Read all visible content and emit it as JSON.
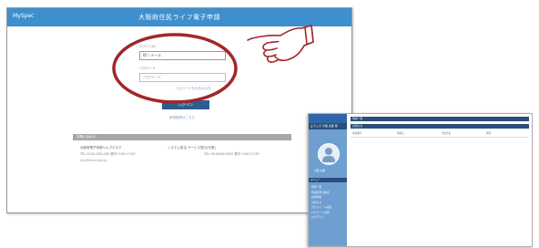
{
  "login_screen": {
    "header": {
      "brand": "MySpec",
      "title": "大阪府住民ライフ電子申請"
    },
    "form": {
      "login_id_label": "ログインID",
      "login_id_value": "ID / メール",
      "password_label": "パスワード",
      "password_placeholder": "パスワード",
      "forgot_link": "パスワードをお忘れの方",
      "login_button": "ログイン",
      "signup_link": "新規登録はこちら"
    },
    "notice": {
      "heading": "お問い合わせ",
      "contacts": [
        {
          "name": "大阪府電子申請ヘルプデスク",
          "tel": "TEL 0120-000-000  受付 9:00-17:00",
          "mail": "info@example.jp"
        },
        {
          "name": "システム担当  サービス窓口(代表)",
          "tel": "TEL 06-0000-0000  受付 9:00-17:30"
        }
      ]
    },
    "annotation": {
      "highlight_color": "#a3262a",
      "hand_icon": "pointing-hand-icon"
    }
  },
  "dashboard_screen": {
    "sidebar": {
      "header": "申請者用画面",
      "user_strip": "ようこそ 大阪 太郎 様",
      "username": "大阪 太郎",
      "menu_heading": "メニュー",
      "menu_items": [
        "申請一覧",
        "申請状況の確認",
        "新規申請",
        "お知らせ",
        "プロフィール設定",
        "パスワード変更",
        "ログアウト"
      ]
    },
    "main": {
      "top_bar": "申請一覧",
      "section_bar": "お知らせ",
      "rows": [
        [
          "申請番号",
          "申請日",
          "手続き名",
          "状況"
        ]
      ]
    }
  }
}
